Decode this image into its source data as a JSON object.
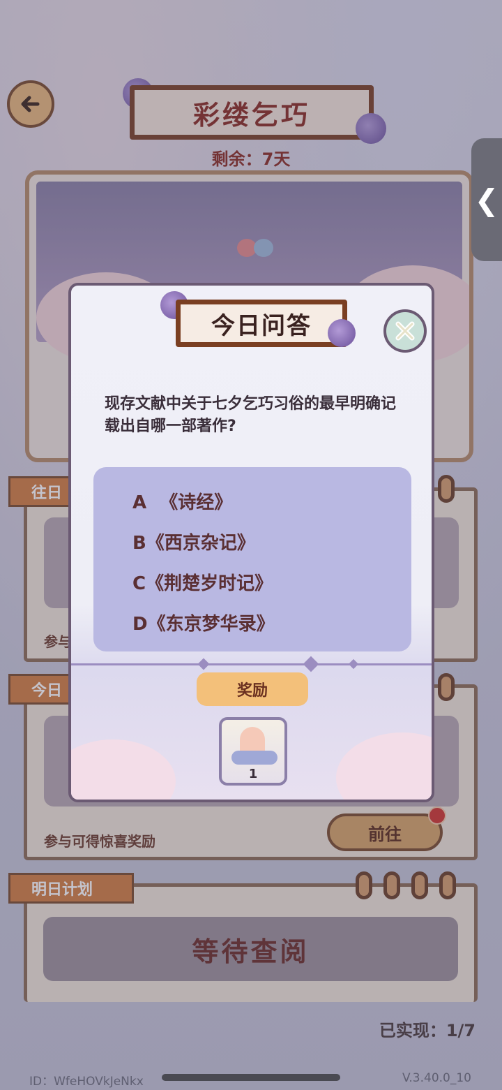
{
  "header": {
    "title": "彩缕乞巧",
    "remaining": "剩余：7天"
  },
  "side_tab": {
    "glyph": "❮"
  },
  "panels": {
    "past_tag": "往日",
    "today_tag": "今日",
    "participate_text_1": "参与",
    "participate_text_2": "参与可得惊喜奖励",
    "goto_label": "前往",
    "tomorrow_tag": "明日计划",
    "waiting_label": "等待查阅"
  },
  "dialog": {
    "title": "今日问答",
    "question": "现存文献中关于七夕乞巧习俗的最早明确记载出自哪一部著作?",
    "options": [
      {
        "letter": "A",
        "text": "《诗经》"
      },
      {
        "letter": "B",
        "text": "《西京杂记》"
      },
      {
        "letter": "C",
        "text": "《荆楚岁时记》"
      },
      {
        "letter": "D",
        "text": "《东京梦华录》"
      }
    ],
    "reward_label": "奖励",
    "reward_count": "1"
  },
  "footer": {
    "achieved": "已实现：1/7",
    "id": "ID：WfeHOVkJeNkx",
    "version": "V.3.40.0_10"
  },
  "colors": {
    "title_red": "#8a2a20",
    "wood": "#7a3f22",
    "option_bg": "#b9b8e2",
    "reward_bg": "#f3c07a"
  }
}
